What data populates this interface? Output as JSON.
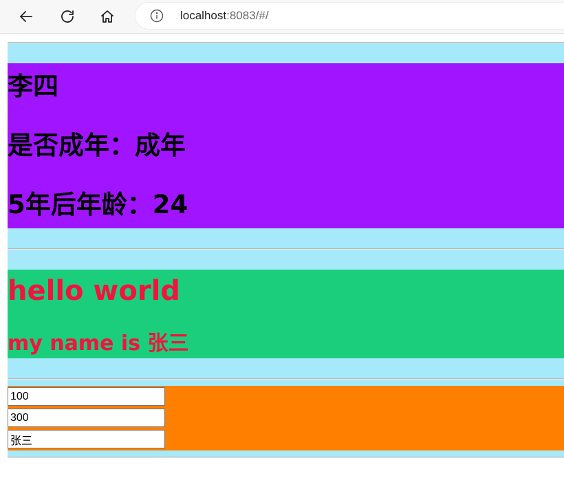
{
  "browser": {
    "url_host": "localhost",
    "url_rest": ":8083/#/"
  },
  "person": {
    "name": "李四",
    "adult_line": "是否成年：成年",
    "age_line": "5年后年龄：24"
  },
  "greeting": {
    "title": "hello world",
    "subtitle": "my name is 张三"
  },
  "inputs": {
    "first": "100",
    "second": "300",
    "third": "张三"
  },
  "colors": {
    "section_bg": "#a6e9fb",
    "purple": "#a014ff",
    "green": "#1bce7c",
    "orange": "#ff8000",
    "red_text": "#f4123e"
  }
}
